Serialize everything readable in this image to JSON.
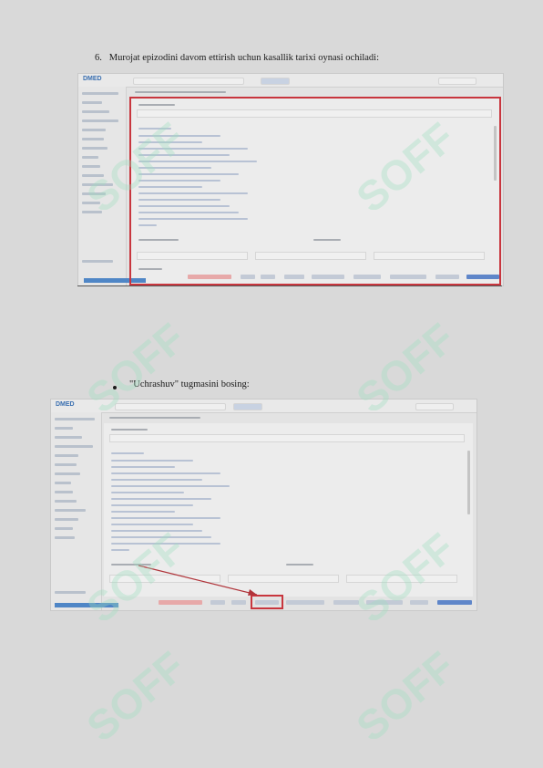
{
  "step1": {
    "number": "6.",
    "text": "Murojat epizodini davom ettirish uchun kasallik tarixi oynasi ochiladi:"
  },
  "step2": {
    "text": "\"Uchrashuv\" tugmasini bosing:"
  },
  "screenshot": {
    "logo": "DMED"
  },
  "watermark": {
    "text": "SOFF"
  },
  "colors": {
    "highlight": "#c8363e",
    "accent": "#3a6fb0",
    "watermark": "#9fe0c0"
  }
}
